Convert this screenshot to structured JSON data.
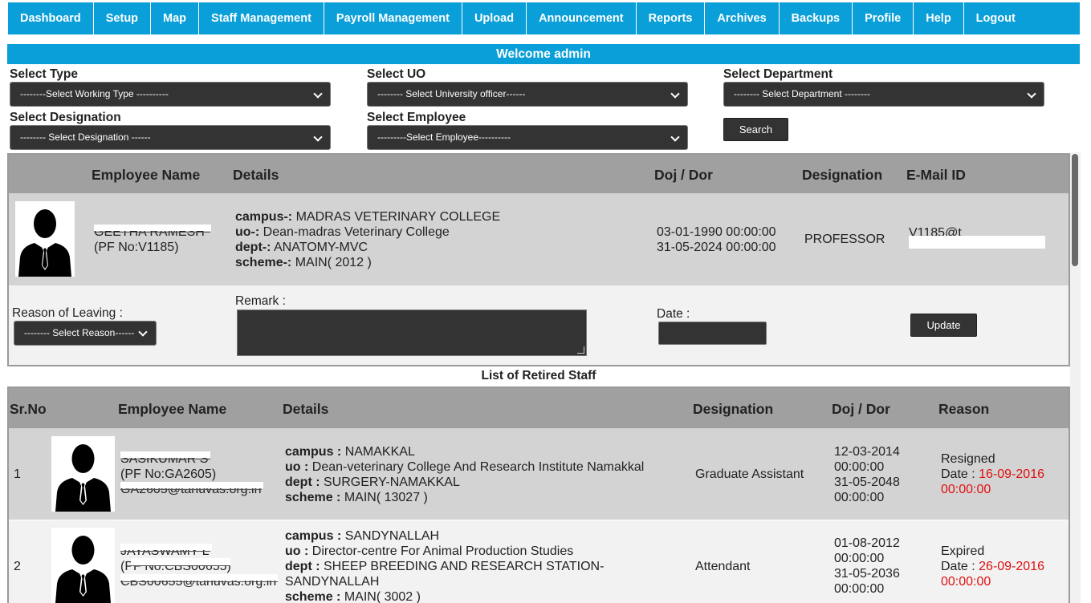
{
  "nav": [
    "Dashboard",
    "Setup",
    "Map",
    "Staff Management",
    "Payroll Management",
    "Upload",
    "Announcement",
    "Reports",
    "Archives",
    "Backups",
    "Profile",
    "Help",
    "Logout"
  ],
  "welcome": "Welcome admin",
  "filters": {
    "type_label": "Select Type",
    "type_value": "--------Select Working Type ----------",
    "uo_label": "Select UO",
    "uo_value": "-------- Select University officer------",
    "dept_label": "Select Department",
    "dept_value": "-------- Select Department --------",
    "desig_label": "Select Designation",
    "desig_value": "-------- Select Designation ------",
    "emp_label": "Select Employee",
    "emp_value": "---------Select Employee----------",
    "search": "Search"
  },
  "employee_table": {
    "headers": [
      "Employee Name",
      "Details",
      "Doj / Dor",
      "Designation",
      "E-Mail ID"
    ],
    "row": {
      "name": "GEETHA RAMESH",
      "pf": "(PF No:V1185)",
      "campus_label": "campus-:",
      "campus": "MADRAS VETERINARY COLLEGE",
      "uo_label": "uo-:",
      "uo": "Dean-madras Veterinary College",
      "dept_label": "dept-:",
      "dept": "ANATOMY-MVC",
      "scheme_label": "scheme-:",
      "scheme": "MAIN( 2012 )",
      "doj": "03-01-1990 00:00:00",
      "dor": "31-05-2024 00:00:00",
      "designation": "PROFESSOR",
      "email": "V1185@t"
    },
    "form": {
      "reason_label": "Reason of Leaving :",
      "reason_value": "-------- Select Reason------",
      "remark_label": "Remark :",
      "date_label": "Date :",
      "update": "Update"
    }
  },
  "retired": {
    "title": "List of Retired Staff",
    "headers": [
      "Sr.No",
      "Employee Name",
      "Details",
      "Designation",
      "Doj / Dor",
      "Reason"
    ],
    "rows": [
      {
        "sr": "1",
        "name": "SASIKUMAR S",
        "pf": "(PF No:GA2605)",
        "email": "GA2605@tanuvas.org.in",
        "campus_label": "campus :",
        "campus": "NAMAKKAL",
        "uo_label": "uo :",
        "uo": "Dean-veterinary College And Research Institute Namakkal",
        "dept_label": "dept :",
        "dept": "SURGERY-NAMAKKAL",
        "scheme_label": "scheme :",
        "scheme": "MAIN( 13027 )",
        "designation": "Graduate Assistant",
        "doj_date": "12-03-2014",
        "doj_time": "00:00:00",
        "dor_date": "31-05-2048",
        "dor_time": "00:00:00",
        "reason": "Resigned",
        "date_label": "Date :",
        "date_value": "16-09-2016",
        "date_time": "00:00:00"
      },
      {
        "sr": "2",
        "name": "JAYASWAMY L",
        "pf": "(PF No:CBS00655)",
        "email": "CBS00655@tanuvas.org.in",
        "campus_label": "campus :",
        "campus": "SANDYNALLAH",
        "uo_label": "uo :",
        "uo": "Director-centre For Animal Production Studies",
        "dept_label": "dept :",
        "dept": "SHEEP BREEDING AND RESEARCH STATION-",
        "dept2": "SANDYNALLAH",
        "scheme_label": "scheme :",
        "scheme": "MAIN( 3002 )",
        "designation": "Attendant",
        "doj_date": "01-08-2012",
        "doj_time": "00:00:00",
        "dor_date": "31-05-2036",
        "dor_time": "00:00:00",
        "reason": "Expired",
        "date_label": "Date :",
        "date_value": "26-09-2016",
        "date_time": "00:00:00"
      }
    ]
  }
}
